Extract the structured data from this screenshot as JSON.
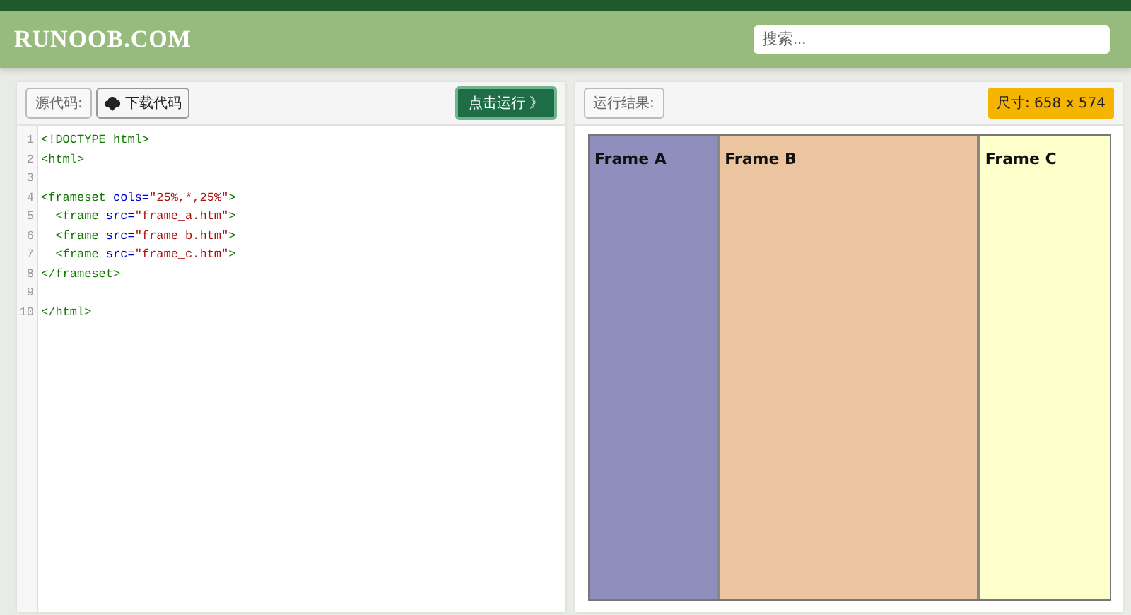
{
  "header": {
    "logo": "RUNOOB.COM",
    "search": {
      "placeholder": "搜索..."
    }
  },
  "source_panel": {
    "label": "源代码:",
    "download_button": "下载代码",
    "run_button": "点击运行 》",
    "code_lines": [
      {
        "number": "1",
        "tokens": [
          {
            "kind": "tag",
            "text": "<!DOCTYPE html>"
          }
        ]
      },
      {
        "number": "2",
        "tokens": [
          {
            "kind": "tag",
            "text": "<html>"
          }
        ]
      },
      {
        "number": "3"
      },
      {
        "number": "4",
        "tokens": [
          {
            "kind": "tag",
            "text": "<frameset"
          },
          {
            "kind": "attr",
            "text": " cols="
          },
          {
            "kind": "string",
            "text": "\"25%,*,25%\""
          },
          {
            "kind": "tag",
            "text": ">"
          }
        ]
      },
      {
        "number": "5",
        "tokens": [
          {
            "kind": "tag",
            "text": "  <frame"
          },
          {
            "kind": "attr",
            "text": " src="
          },
          {
            "kind": "string",
            "text": "\"frame_a.htm\""
          },
          {
            "kind": "tag",
            "text": ">"
          }
        ]
      },
      {
        "number": "6",
        "tokens": [
          {
            "kind": "tag",
            "text": "  <frame"
          },
          {
            "kind": "attr",
            "text": " src="
          },
          {
            "kind": "string",
            "text": "\"frame_b.htm\""
          },
          {
            "kind": "tag",
            "text": ">"
          }
        ]
      },
      {
        "number": "7",
        "tokens": [
          {
            "kind": "tag",
            "text": "  <frame"
          },
          {
            "kind": "attr",
            "text": " src="
          },
          {
            "kind": "string",
            "text": "\"frame_c.htm\""
          },
          {
            "kind": "tag",
            "text": ">"
          }
        ]
      },
      {
        "number": "8",
        "tokens": [
          {
            "kind": "tag",
            "text": "</frameset>"
          }
        ]
      },
      {
        "number": "9"
      },
      {
        "number": "10",
        "tokens": [
          {
            "kind": "tag",
            "text": "</html>"
          }
        ]
      }
    ]
  },
  "result_panel": {
    "label": "运行结果:",
    "size_badge": "尺寸: 658 x 574",
    "frames": [
      {
        "title": "Frame A",
        "color": "#8f8fbd"
      },
      {
        "title": "Frame B",
        "color": "#ebc5a0"
      },
      {
        "title": "Frame C",
        "color": "#ffffcc"
      }
    ]
  }
}
